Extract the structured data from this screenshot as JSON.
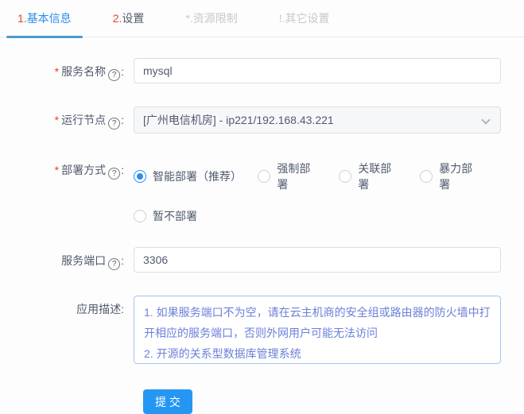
{
  "tabs": [
    {
      "prefix": "1.",
      "label": "基本信息",
      "state": "active"
    },
    {
      "prefix": "2.",
      "label": "设置",
      "state": "normal"
    },
    {
      "prefix": "*.",
      "label": "资源限制",
      "state": "disabled"
    },
    {
      "prefix": "!.",
      "label": "其它设置",
      "state": "disabled"
    }
  ],
  "colon": ":",
  "required_mark": "*",
  "icons": {
    "help": "?",
    "chevron_down": "chevron-down"
  },
  "form": {
    "service_name": {
      "label": "服务名称",
      "value": "mysql"
    },
    "run_node": {
      "label": "运行节点",
      "value": "[广州电信机房] - ip221/192.168.43.221"
    },
    "deploy_mode": {
      "label": "部署方式",
      "options": [
        {
          "label": "智能部署（推荐）",
          "selected": true
        },
        {
          "label": "强制部署",
          "selected": false
        },
        {
          "label": "关联部署",
          "selected": false
        },
        {
          "label": "暴力部署",
          "selected": false
        },
        {
          "label": "暂不部署",
          "selected": false
        }
      ]
    },
    "service_port": {
      "label": "服务端口",
      "value": "3306"
    },
    "app_description": {
      "label": "应用描述",
      "value": "1. 如果服务端口不为空，请在云主机商的安全组或路由器的防火墙中打开相应的服务端口，否则外网用户可能无法访问\n2. 开源的关系型数据库管理系统"
    }
  },
  "submit": {
    "label": "提 交"
  },
  "colors": {
    "accent_blue": "#2d8cf0",
    "tab_underline_blue": "#4a9bd1",
    "tab_prefix_red": "#df4633",
    "required_red": "#ed4014",
    "disabled_gray": "#c5c8ce",
    "description_text_blue": "#6b80d8",
    "submit_blue": "#2597f3",
    "select_background": "#f6f7f9"
  }
}
